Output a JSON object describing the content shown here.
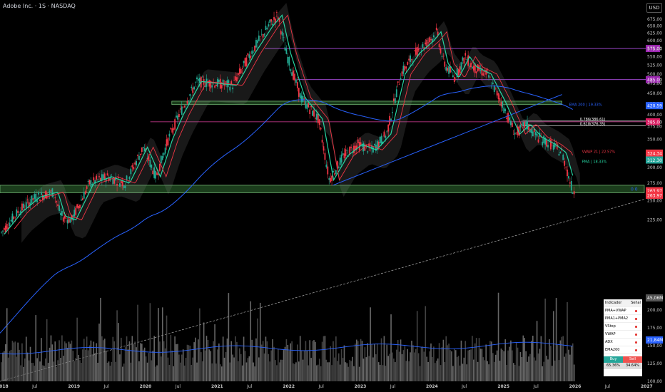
{
  "header": {
    "title": "Adobe Inc. · 1S · NASDAQ",
    "currency": "USD"
  },
  "colors": {
    "up": "#22ab94",
    "down": "#f23645",
    "ema200": "#2962ff",
    "vwap": "#f23645",
    "pma": "#26d7a3",
    "level": "#b04fe6",
    "fib": "#ffffff",
    "zone": "#4caf50"
  },
  "chart_data": {
    "type": "candlestick",
    "x_ticks": [
      "2018",
      "Jul",
      "2019",
      "Jul",
      "2020",
      "Jul",
      "2021",
      "Jul",
      "2022",
      "Jul",
      "2023",
      "Jul",
      "2024",
      "Jul",
      "2025",
      "Jul",
      "2026",
      "Jul",
      "2027"
    ],
    "x_tick_years": [
      2018.0,
      2018.5,
      2019.0,
      2019.5,
      2020.0,
      2020.5,
      2021.0,
      2021.5,
      2022.0,
      2022.5,
      2023.0,
      2023.5,
      2024.0,
      2024.5,
      2025.0,
      2025.5,
      2026.0,
      2026.5,
      2027.0
    ],
    "x_range": [
      2018.0,
      2027.0
    ],
    "y_ticks": [
      675,
      650,
      625,
      600,
      575,
      550,
      525,
      500,
      475,
      450,
      425,
      400,
      375,
      350,
      325,
      300,
      275,
      250,
      225,
      200,
      175,
      150,
      125,
      100
    ],
    "y_tick_labels": [
      "675,00",
      "650,00",
      "625,00",
      "600,00",
      "575,00",
      "550,00",
      "525,00",
      "500,00",
      "475,00",
      "450,00",
      "425,00",
      "400,00",
      "375,00",
      "350,00",
      "325,00",
      "300,00",
      "275,00",
      "250,00",
      "225,00",
      "200,00",
      "175,00",
      "150,00",
      "125,00",
      "100,00"
    ],
    "y_scale": "log",
    "y_range": [
      93,
      710
    ],
    "price_path": [
      [
        2018.0,
        208
      ],
      [
        2018.25,
        235
      ],
      [
        2018.5,
        255
      ],
      [
        2018.75,
        262
      ],
      [
        2018.85,
        230
      ],
      [
        2019.0,
        225
      ],
      [
        2019.25,
        275
      ],
      [
        2019.5,
        285
      ],
      [
        2019.75,
        275
      ],
      [
        2020.0,
        335
      ],
      [
        2020.18,
        285
      ],
      [
        2020.35,
        350
      ],
      [
        2020.5,
        400
      ],
      [
        2020.75,
        480
      ],
      [
        2021.0,
        475
      ],
      [
        2021.25,
        470
      ],
      [
        2021.5,
        560
      ],
      [
        2021.75,
        650
      ],
      [
        2021.88,
        690
      ],
      [
        2022.0,
        560
      ],
      [
        2022.2,
        440
      ],
      [
        2022.45,
        390
      ],
      [
        2022.6,
        280
      ],
      [
        2022.8,
        320
      ],
      [
        2023.0,
        340
      ],
      [
        2023.2,
        330
      ],
      [
        2023.4,
        360
      ],
      [
        2023.6,
        500
      ],
      [
        2023.8,
        560
      ],
      [
        2024.0,
        600
      ],
      [
        2024.1,
        630
      ],
      [
        2024.2,
        530
      ],
      [
        2024.35,
        490
      ],
      [
        2024.5,
        550
      ],
      [
        2024.6,
        520
      ],
      [
        2024.8,
        500
      ],
      [
        2025.0,
        430
      ],
      [
        2025.2,
        360
      ],
      [
        2025.35,
        380
      ],
      [
        2025.5,
        355
      ],
      [
        2025.7,
        340
      ],
      [
        2025.85,
        325
      ],
      [
        2026.0,
        264
      ]
    ],
    "horizontal_levels": [
      {
        "price": 575.0,
        "label": "575,00"
      },
      {
        "price": 485.0,
        "label": "485,00"
      },
      {
        "price": 385.0,
        "label": "385,00"
      }
    ],
    "fib_levels": [
      {
        "ratio": "0.786",
        "price": 386.61,
        "label": "0.786(386.61)"
      },
      {
        "ratio": "0.618",
        "price": 376.35,
        "label": "0.618(376.35)"
      }
    ],
    "zones": [
      {
        "label": "upper-zone",
        "from_year": 2020.4,
        "to_year": 2025.85,
        "low": 423,
        "high": 431
      },
      {
        "label": "lower-zone",
        "from_year": 2018.0,
        "to_year": 2027.0,
        "low": 261,
        "high": 272
      }
    ],
    "indicators": [
      {
        "name": "EMA 200",
        "value": "EMA 200 | 19.33%",
        "last": "420,59"
      },
      {
        "name": "VWAP",
        "value": "VWAP 21 | 22.57%",
        "last": "324,34"
      },
      {
        "name": "PMA",
        "value": "PMA | 18.33%",
        "last": "312,30"
      }
    ],
    "price_labels": [
      {
        "text": "263,97",
        "price": 263.97
      },
      {
        "text": "263,97",
        "price": 257.5
      }
    ],
    "volume_labels": [
      "45,06M",
      "21,84M"
    ]
  },
  "signal_table": {
    "headers": [
      "Indicador",
      "Señal"
    ],
    "rows": [
      "PMA+VWAP",
      "PMA1+PMA2",
      "VStop",
      "VWAP",
      "ADX",
      "EMA200"
    ],
    "buy": "Buy",
    "sell": "Sell",
    "buy_value": "65.36%",
    "sell_value": "34.64%"
  },
  "extras": {
    "zero_label": "0 0"
  }
}
